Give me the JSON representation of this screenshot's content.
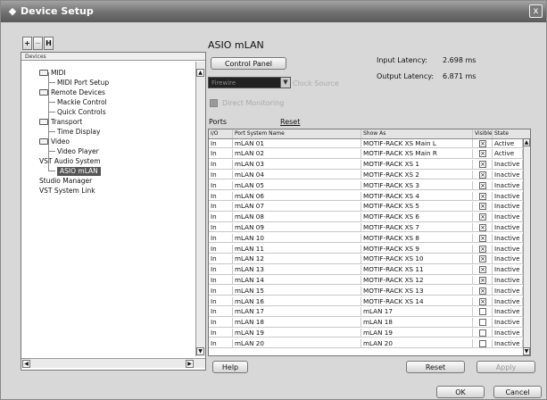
{
  "window": {
    "title": "Device Setup",
    "close_label": "x"
  },
  "tree": {
    "toolbar": [
      "+",
      "−",
      "H"
    ],
    "header": "Devices",
    "items": [
      {
        "label": "MIDI",
        "depth": 0,
        "folder": true
      },
      {
        "label": "MIDI Port Setup",
        "depth": 1
      },
      {
        "label": "Remote Devices",
        "depth": 0,
        "folder": true
      },
      {
        "label": "Mackie Control",
        "depth": 1
      },
      {
        "label": "Quick Controls",
        "depth": 1
      },
      {
        "label": "Transport",
        "depth": 0,
        "folder": true
      },
      {
        "label": "Time Display",
        "depth": 1
      },
      {
        "label": "Video",
        "depth": 0,
        "folder": true
      },
      {
        "label": "Video Player",
        "depth": 1
      },
      {
        "label": "VST Audio System",
        "depth": 0
      },
      {
        "label": "ASIO mLAN",
        "depth": 1,
        "selected": true
      },
      {
        "label": "Studio Manager",
        "depth": 0
      },
      {
        "label": "VST System Link",
        "depth": 0
      }
    ]
  },
  "panel": {
    "title": "ASIO mLAN",
    "control_panel": "Control Panel",
    "input_latency_label": "Input Latency:",
    "input_latency_value": "2.698 ms",
    "output_latency_label": "Output Latency:",
    "output_latency_value": "6.871 ms",
    "clock_select_value": "Firewire",
    "clock_source": "Clock Source",
    "direct_monitoring": "Direct Monitoring",
    "ports_label": "Ports",
    "reset_link": "Reset"
  },
  "table": {
    "columns": [
      "I/O",
      "Port System Name",
      "Show As",
      "Visible",
      "State"
    ],
    "rows": [
      {
        "io": "In",
        "name": "mLAN 01",
        "show_as": "MOTIF-RACK XS Main L",
        "visible": true,
        "state": "Active"
      },
      {
        "io": "In",
        "name": "mLAN 02",
        "show_as": "MOTIF-RACK XS Main R",
        "visible": true,
        "state": "Active"
      },
      {
        "io": "In",
        "name": "mLAN 03",
        "show_as": "MOTIF-RACK XS 1",
        "visible": true,
        "state": "Inactive"
      },
      {
        "io": "In",
        "name": "mLAN 04",
        "show_as": "MOTIF-RACK XS 2",
        "visible": true,
        "state": "Inactive"
      },
      {
        "io": "In",
        "name": "mLAN 05",
        "show_as": "MOTIF-RACK XS 3",
        "visible": true,
        "state": "Inactive"
      },
      {
        "io": "In",
        "name": "mLAN 06",
        "show_as": "MOTIF-RACK XS 4",
        "visible": true,
        "state": "Inactive"
      },
      {
        "io": "In",
        "name": "mLAN 07",
        "show_as": "MOTIF-RACK XS 5",
        "visible": true,
        "state": "Inactive"
      },
      {
        "io": "In",
        "name": "mLAN 08",
        "show_as": "MOTIF-RACK XS 6",
        "visible": true,
        "state": "Inactive"
      },
      {
        "io": "In",
        "name": "mLAN 09",
        "show_as": "MOTIF-RACK XS 7",
        "visible": true,
        "state": "Inactive"
      },
      {
        "io": "In",
        "name": "mLAN 10",
        "show_as": "MOTIF-RACK XS 8",
        "visible": true,
        "state": "Inactive"
      },
      {
        "io": "In",
        "name": "mLAN 11",
        "show_as": "MOTIF-RACK XS 9",
        "visible": true,
        "state": "Inactive"
      },
      {
        "io": "In",
        "name": "mLAN 12",
        "show_as": "MOTIF-RACK XS 10",
        "visible": true,
        "state": "Inactive"
      },
      {
        "io": "In",
        "name": "mLAN 13",
        "show_as": "MOTIF-RACK XS 11",
        "visible": true,
        "state": "Inactive"
      },
      {
        "io": "In",
        "name": "mLAN 14",
        "show_as": "MOTIF-RACK XS 12",
        "visible": true,
        "state": "Inactive"
      },
      {
        "io": "In",
        "name": "mLAN 15",
        "show_as": "MOTIF-RACK XS 13",
        "visible": true,
        "state": "Inactive"
      },
      {
        "io": "In",
        "name": "mLAN 16",
        "show_as": "MOTIF-RACK XS 14",
        "visible": true,
        "state": "Inactive"
      },
      {
        "io": "In",
        "name": "mLAN 17",
        "show_as": "mLAN 17",
        "visible": false,
        "state": "Inactive"
      },
      {
        "io": "In",
        "name": "mLAN 18",
        "show_as": "mLAN 18",
        "visible": false,
        "state": "Inactive"
      },
      {
        "io": "In",
        "name": "mLAN 19",
        "show_as": "mLAN 19",
        "visible": false,
        "state": "Inactive"
      },
      {
        "io": "In",
        "name": "mLAN 20",
        "show_as": "mLAN 20",
        "visible": false,
        "state": "Inactive"
      }
    ]
  },
  "buttons": {
    "help": "Help",
    "reset": "Reset",
    "apply": "Apply",
    "ok": "OK",
    "cancel": "Cancel"
  },
  "icons": {
    "checkbox_checked": "×",
    "scroll_up": "▲",
    "scroll_down": "▼",
    "scroll_left": "◀",
    "scroll_right": "▶",
    "dropdown": "▼",
    "video_player": "video-player-icon",
    "midi_port": "midi-port-icon",
    "vst_audio": "vst-audio-icon"
  }
}
